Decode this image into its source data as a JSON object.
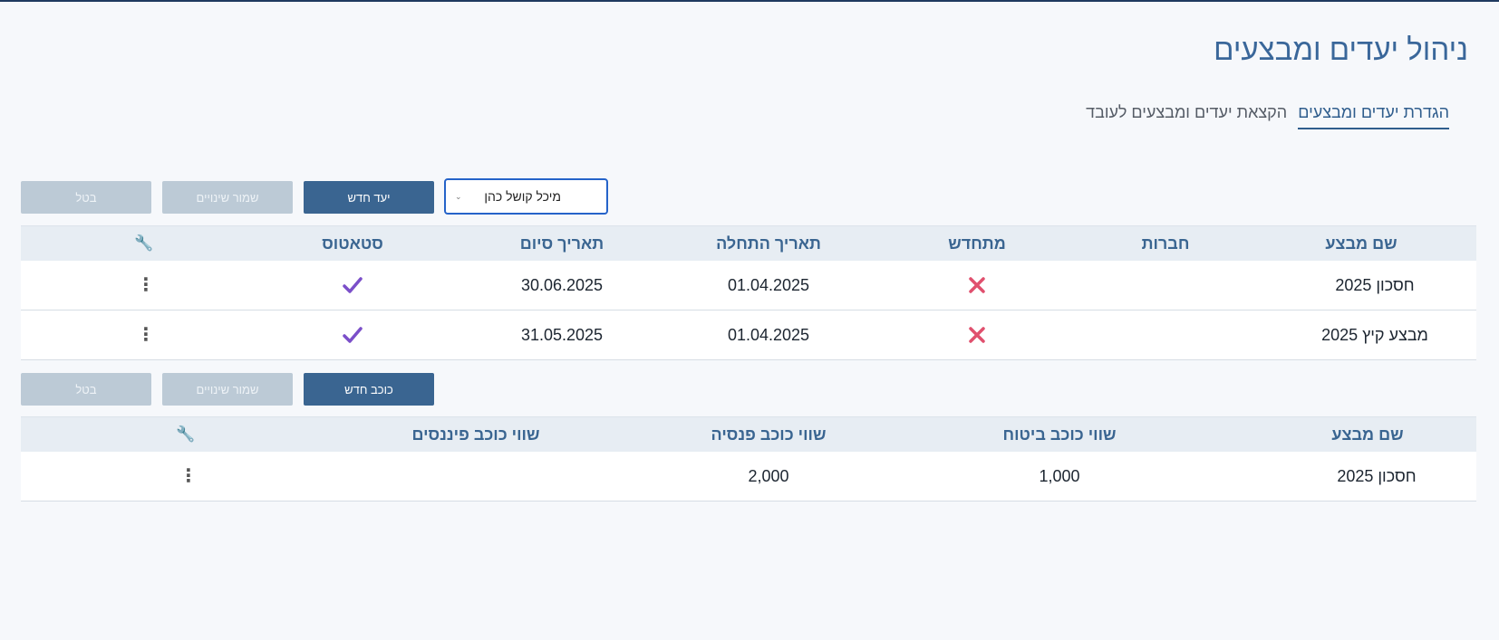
{
  "page": {
    "title": "ניהול יעדים ומבצעים"
  },
  "tabs": [
    {
      "label": "הגדרת יעדים ומבצעים",
      "active": true
    },
    {
      "label": "הקצאת יעדים ומבצעים לעובד",
      "active": false
    }
  ],
  "toolbar1": {
    "employee_select": "מיכל קושל כהן",
    "new_label": "יעד חדש",
    "save_label": "שמור שינויים",
    "cancel_label": "בטל"
  },
  "table1": {
    "headers": {
      "campaign_name": "שם מבצע",
      "companies": "חברות",
      "recurring": "מתחדש",
      "start_date": "תאריך התחלה",
      "end_date": "תאריך סיום",
      "status": "סטאטוס"
    },
    "rows": [
      {
        "campaign_name": "חסכון 2025",
        "companies": "",
        "recurring": "cross-icon",
        "start_date": "01.04.2025",
        "end_date": "30.06.2025",
        "status": "check-icon"
      },
      {
        "campaign_name": "מבצע קיץ 2025",
        "companies": "",
        "recurring": "cross-icon",
        "start_date": "01.04.2025",
        "end_date": "31.05.2025",
        "status": "check-icon"
      }
    ]
  },
  "toolbar2": {
    "new_label": "כוכב חדש",
    "save_label": "שמור שינויים",
    "cancel_label": "בטל"
  },
  "table2": {
    "headers": {
      "campaign_name": "שם מבצע",
      "insurance_star": "שווי כוכב ביטוח",
      "pension_star": "שווי כוכב פנסיה",
      "finance_star": "שווי כוכב פיננסים"
    },
    "rows": [
      {
        "campaign_name": "חסכון 2025",
        "insurance_star": "1,000",
        "pension_star": "2,000",
        "finance_star": ""
      }
    ]
  },
  "colors": {
    "accent": "#3a6591",
    "title": "#3a679a",
    "cross": "#e0506e",
    "check": "#7b4fc9"
  }
}
